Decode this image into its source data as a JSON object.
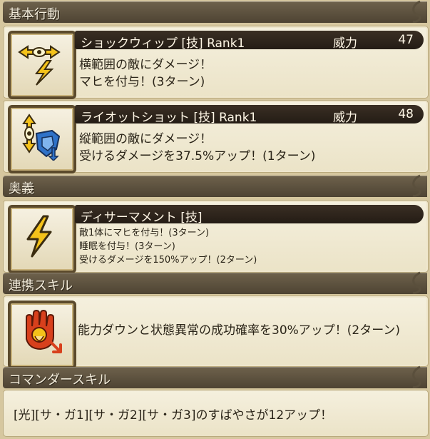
{
  "sections": {
    "basic": "基本行動",
    "ougi": "奥義",
    "renkei": "連携スキル",
    "commander": "コマンダースキル"
  },
  "skills": [
    {
      "name": "ショックウィップ [技]  Rank1",
      "power_label": "威力",
      "power_value": "47",
      "lines": [
        "横範囲の敵にダメージ！",
        "マヒを付与！(3ターン)"
      ]
    },
    {
      "name": "ライオットショット [技]  Rank1",
      "power_label": "威力",
      "power_value": "48",
      "lines": [
        "縦範囲の敵にダメージ！",
        "受けるダメージを37.5%アップ！(1ターン)"
      ]
    }
  ],
  "ougi": {
    "name": "ディサーマメント [技]",
    "lines": [
      "敵1体にマヒを付与！(3ターン)",
      "睡眠を付与！(3ターン)",
      "受けるダメージを150%アップ！(2ターン)"
    ]
  },
  "renkei": {
    "text": "能力ダウンと状態異常の成功確率を30%アップ！(2ターン)"
  },
  "commander": {
    "text": "[光][サ・ガ1][サ・ガ2][サ・ガ3]のすばやさが12アップ！"
  },
  "icons": {
    "skill1": "shock-whip-icon",
    "skill2": "riot-shot-icon",
    "ougi": "lightning-icon",
    "renkei": "hand-debuff-icon"
  },
  "colors": {
    "header_bg": "#5a4f3c",
    "title_bar_bg": "#2c241c",
    "card_bg": "#f2ecd6",
    "lightning_yellow": "#f4c21a",
    "shield_blue": "#2f72c8",
    "hand_red": "#d8401c"
  }
}
